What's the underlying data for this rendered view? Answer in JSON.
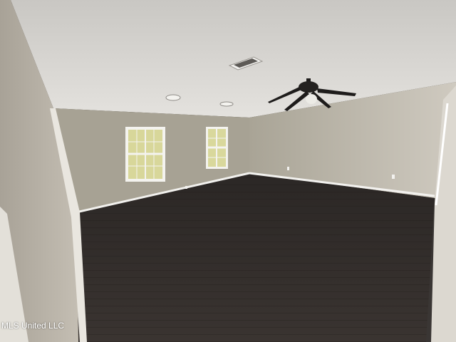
{
  "photo": {
    "watermark": "MLS United LLC"
  },
  "colors": {
    "ceiling": "#d9d7d3",
    "left_wall": "#b9b3a8",
    "back_wall": "#a6a193",
    "right_wall": "#bfbab0",
    "floor": "#2f2a27",
    "trim": "#f2f1ee",
    "window_glass": "#e7e6a8",
    "fan": "#1e1c1b"
  }
}
